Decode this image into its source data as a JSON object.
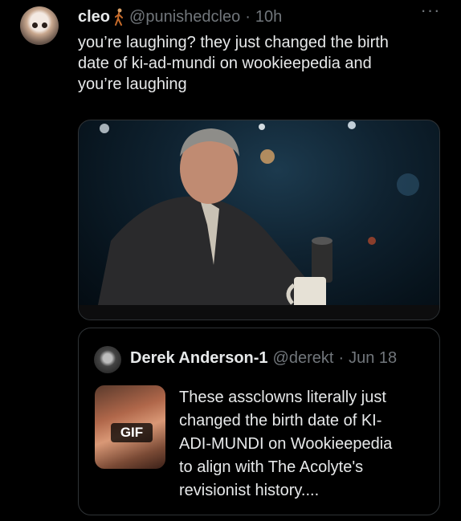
{
  "tweet": {
    "author_name": "cleo",
    "handle": "@punishedcleo",
    "separator": "·",
    "time": "10h",
    "more_icon": "more-icon",
    "text": "you’re laughing? they just changed the birth\ndate of ki-ad-mundi on wookieepedia and\nyou’re laughing"
  },
  "quote": {
    "author_name": "Derek Anderson-1",
    "handle": "@derekt",
    "separator": "·",
    "date": "Jun 18",
    "media_badge": "GIF",
    "text": "These assclowns literally just\nchanged the birth date of KI-\nADI-MUNDI on Wookieepedia\nto align with The Acolyte's\nrevisionist history...."
  }
}
